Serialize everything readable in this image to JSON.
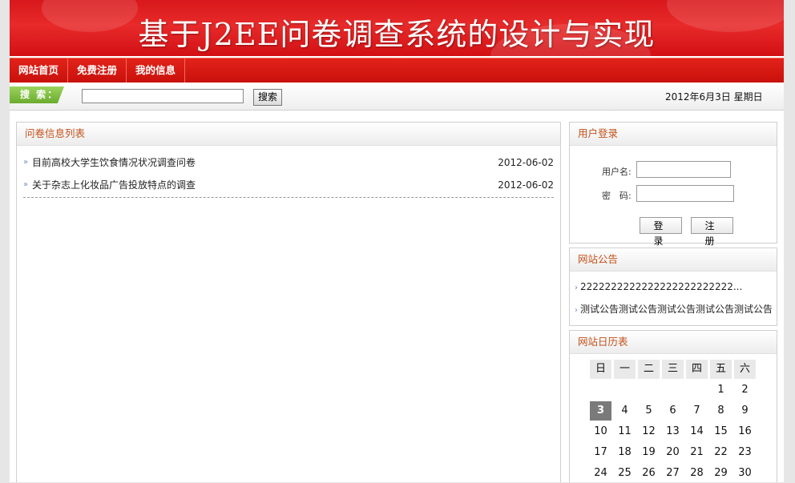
{
  "banner": {
    "title": "基于J2EE问卷调查系统的设计与实现"
  },
  "nav": {
    "items": [
      "网站首页",
      "免费注册",
      "我的信息"
    ]
  },
  "search": {
    "tag": "搜 索：",
    "button": "搜索",
    "value": ""
  },
  "date_text": "2012年6月3日  星期日",
  "survey_list": {
    "title": "问卷信息列表",
    "items": [
      {
        "title": "目前高校大学生饮食情况状况调查问卷",
        "date": "2012-06-02"
      },
      {
        "title": "关于杂志上化妆品广告投放特点的调查",
        "date": "2012-06-02"
      }
    ]
  },
  "login": {
    "title": "用户登录",
    "username_label": "用户名:",
    "password_label": "密　码:",
    "login_button": "登 录",
    "register_button": "注 册"
  },
  "notice": {
    "title": "网站公告",
    "items": [
      "2222222222222222222222222...",
      "测试公告测试公告测试公告测试公告测试公告"
    ]
  },
  "calendar": {
    "title": "网站日历表",
    "weekdays": [
      "日",
      "一",
      "二",
      "三",
      "四",
      "五",
      "六"
    ],
    "weeks": [
      [
        "",
        "",
        "",
        "",
        "",
        "1",
        "2"
      ],
      [
        "3",
        "4",
        "5",
        "6",
        "7",
        "8",
        "9"
      ],
      [
        "10",
        "11",
        "12",
        "13",
        "14",
        "15",
        "16"
      ],
      [
        "17",
        "18",
        "19",
        "20",
        "21",
        "22",
        "23"
      ],
      [
        "24",
        "25",
        "26",
        "27",
        "28",
        "29",
        "30"
      ]
    ],
    "today": "3"
  },
  "colors": {
    "banner_red": "#d8181c",
    "nav_red": "#c9100b",
    "accent_orange": "#c3511b",
    "search_green": "#6aab2e"
  }
}
